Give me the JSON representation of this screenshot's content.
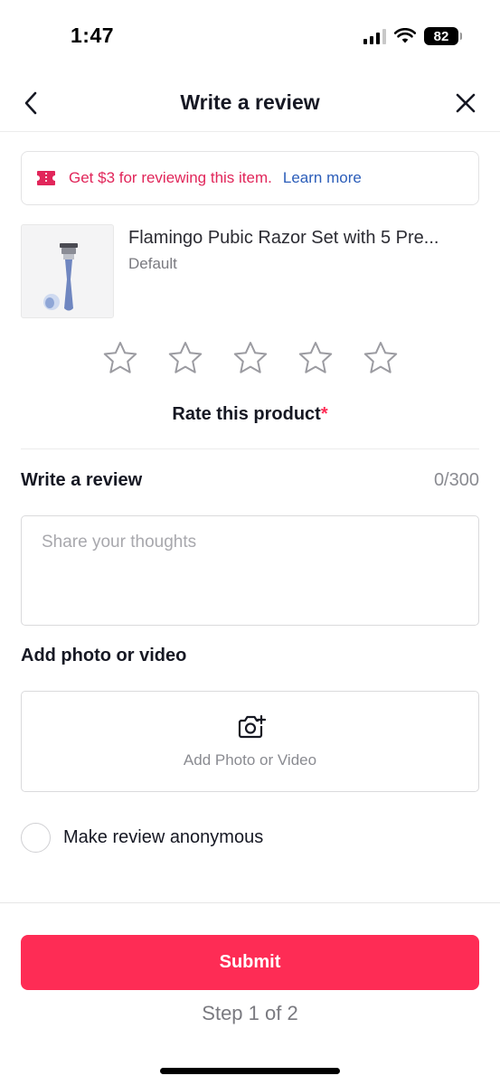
{
  "status_bar": {
    "time": "1:47",
    "battery": "82"
  },
  "nav": {
    "title": "Write a review"
  },
  "promo": {
    "text": "Get $3 for reviewing this item.",
    "link": "Learn more"
  },
  "product": {
    "name": "Flamingo Pubic Razor Set with 5 Pre...",
    "variant": "Default"
  },
  "rating": {
    "label": "Rate this product",
    "required_mark": "*",
    "stars_total": 5,
    "stars_selected": 0
  },
  "review": {
    "title": "Write a review",
    "count": "0/300",
    "placeholder": "Share your thoughts"
  },
  "media": {
    "title": "Add photo or video",
    "button_label": "Add Photo or Video"
  },
  "anonymous": {
    "label": "Make review anonymous",
    "checked": false
  },
  "actions": {
    "submit_label": "Submit",
    "step_text": "Step 1 of 2"
  },
  "colors": {
    "accent": "#fe2c55",
    "promo_text": "#e1265a",
    "link": "#2b5db9"
  }
}
